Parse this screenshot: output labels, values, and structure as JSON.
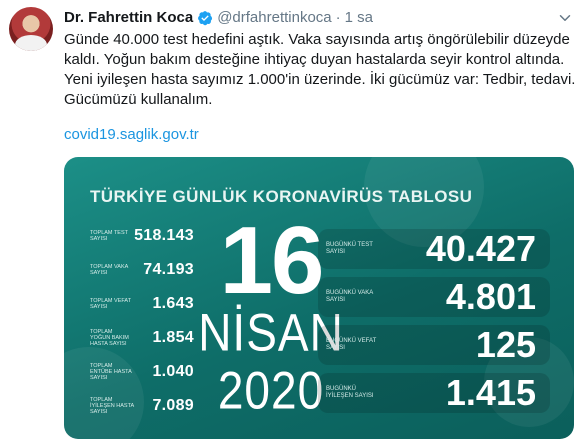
{
  "tweet": {
    "author_name": "Dr. Fahrettin Koca",
    "handle": "@drfahrettinkoca",
    "separator": "·",
    "time": "1 sa",
    "text_lines": [
      "Günde 40.000 test hedefini aştık. Vaka sayısında artış öngörülebilir düzeyde",
      "kaldı. Yoğun bakım desteğine ihtiyaç duyan hastalarda seyir kontrol altında.",
      "Yeni iyileşen hasta sayımız 1.000'in üzerinde. İki gücümüz var: Tedbir, tedavi.",
      "Gücümüzü kullanalım."
    ],
    "link": "covid19.saglik.gov.tr"
  },
  "card": {
    "title": "TÜRKİYE GÜNLÜK KORONAVİRÜS TABLOSU",
    "day": "16",
    "month": "NİSAN",
    "year": "2020",
    "left_stats": [
      {
        "label": "TOPLAM TEST SAYISI",
        "value": "518.143"
      },
      {
        "label": "TOPLAM VAKA SAYISI",
        "value": "74.193"
      },
      {
        "label": "TOPLAM VEFAT SAYISI",
        "value": "1.643"
      },
      {
        "label": "TOPLAM YOĞUN BAKIM HASTA SAYISI",
        "value": "1.854"
      },
      {
        "label": "TOPLAM ENTÜBE HASTA SAYISI",
        "value": "1.040"
      },
      {
        "label": "TOPLAM İYİLEŞEN HASTA SAYISI",
        "value": "7.089"
      }
    ],
    "right_stats": [
      {
        "label": "BUGÜNKÜ TEST SAYISI",
        "value": "40.427"
      },
      {
        "label": "BUGÜNKÜ VAKA SAYISI",
        "value": "4.801"
      },
      {
        "label": "BUGÜNKÜ VEFAT SAYISI",
        "value": "125"
      },
      {
        "label": "BUGÜNKÜ İYİLEŞEN SAYISI",
        "value": "1.415"
      }
    ]
  },
  "colors": {
    "card_bg": "#0e6d68",
    "link": "#1b95e0",
    "verified": "#1da1f2",
    "muted": "#657786"
  },
  "icons": {
    "verified": "verified-badge-icon",
    "menu": "chevron-down-icon"
  }
}
